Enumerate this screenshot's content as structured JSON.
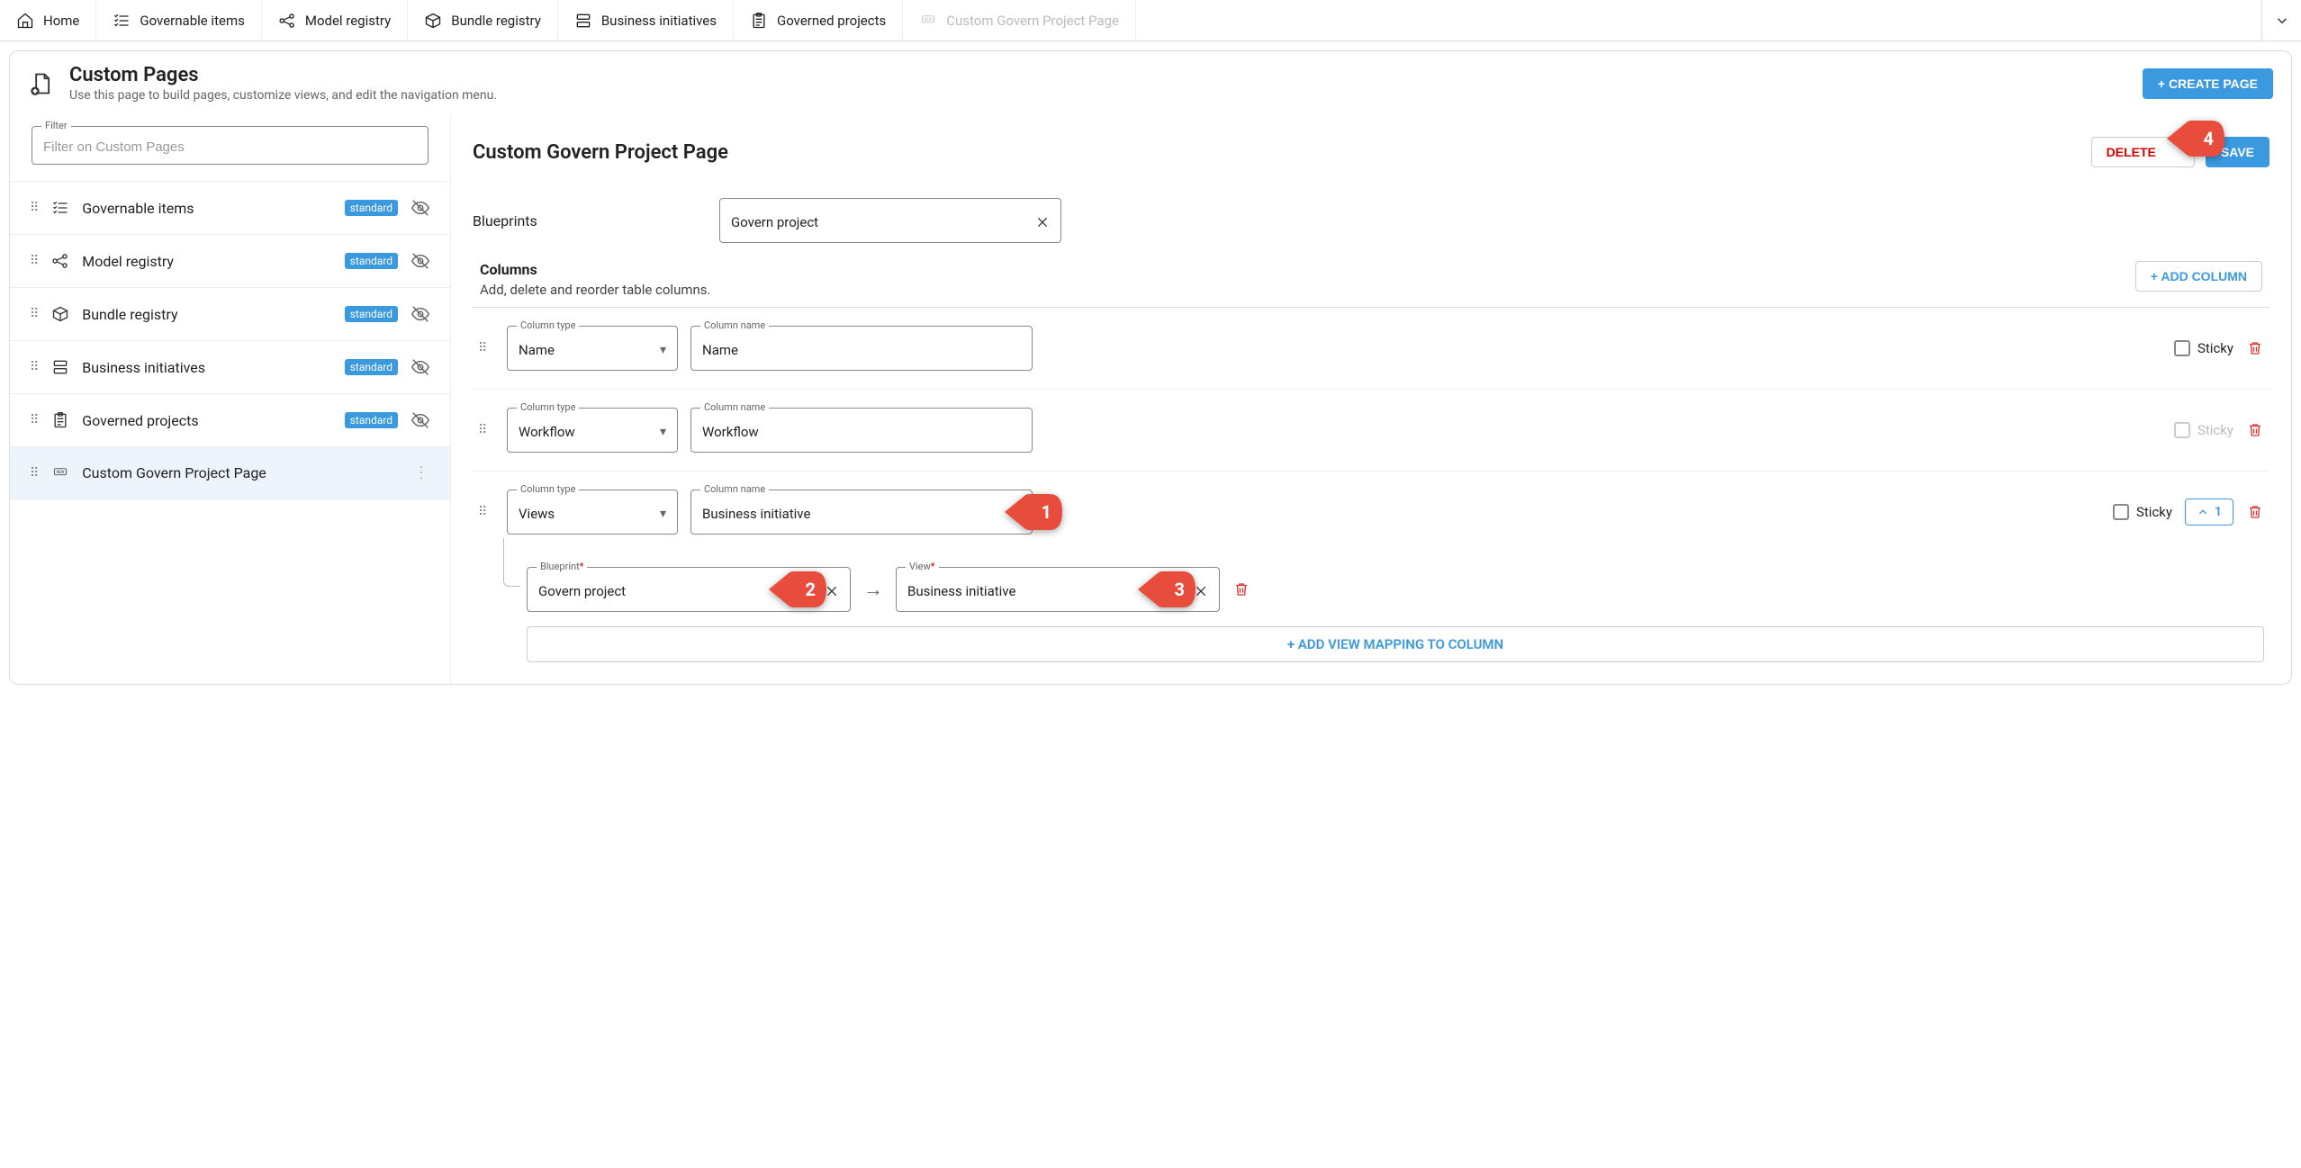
{
  "topnav": {
    "items": [
      {
        "label": "Home",
        "icon": "home-icon"
      },
      {
        "label": "Governable items",
        "icon": "list-check-icon"
      },
      {
        "label": "Model registry",
        "icon": "nodes-icon"
      },
      {
        "label": "Bundle registry",
        "icon": "cube-icon"
      },
      {
        "label": "Business initiatives",
        "icon": "rows-icon"
      },
      {
        "label": "Governed projects",
        "icon": "clipboard-icon"
      },
      {
        "label": "Custom Govern Project Page",
        "icon": "new-icon",
        "inactive": true
      }
    ]
  },
  "header": {
    "title": "Custom Pages",
    "subtitle": "Use this page to build pages, customize views, and edit the navigation menu.",
    "create_btn": "+ CREATE PAGE"
  },
  "filter": {
    "label": "Filter",
    "placeholder": "Filter on Custom Pages"
  },
  "pages": [
    {
      "label": "Governable items",
      "badge": "standard",
      "icon": "list-check-icon",
      "eye_off": true
    },
    {
      "label": "Model registry",
      "badge": "standard",
      "icon": "nodes-icon",
      "eye_off": true
    },
    {
      "label": "Bundle registry",
      "badge": "standard",
      "icon": "cube-icon",
      "eye_off": true
    },
    {
      "label": "Business initiatives",
      "badge": "standard",
      "icon": "rows-icon",
      "eye_off": true
    },
    {
      "label": "Governed projects",
      "badge": "standard",
      "icon": "clipboard-icon",
      "eye_off": true
    },
    {
      "label": "Custom Govern Project Page",
      "badge": null,
      "icon": "new-icon",
      "eye_off": false,
      "selected": true,
      "more": true
    }
  ],
  "detail": {
    "title": "Custom Govern Project Page",
    "delete_btn": "DELETE",
    "save_btn": "SAVE",
    "blueprints": {
      "label": "Blueprints",
      "value": "Govern project"
    },
    "columns_section": {
      "title": "Columns",
      "subtitle": "Add, delete and reorder table columns.",
      "add_btn": "+ ADD COLUMN",
      "type_label": "Column type",
      "name_label": "Column name",
      "sticky_label": "Sticky",
      "expand_count": "1",
      "rows": [
        {
          "type": "Name",
          "name": "Name",
          "sticky_enabled": true
        },
        {
          "type": "Workflow",
          "name": "Workflow",
          "sticky_enabled": false
        },
        {
          "type": "Views",
          "name": "Business initiative",
          "sticky_enabled": true,
          "expandable": true
        }
      ],
      "mapping": {
        "blueprint_label": "Blueprint",
        "blueprint_value": "Govern project",
        "view_label": "View",
        "view_value": "Business initiative",
        "add_btn": "+ ADD VIEW MAPPING TO COLUMN"
      }
    }
  },
  "annotations": {
    "1": "1",
    "2": "2",
    "3": "3",
    "4": "4"
  }
}
